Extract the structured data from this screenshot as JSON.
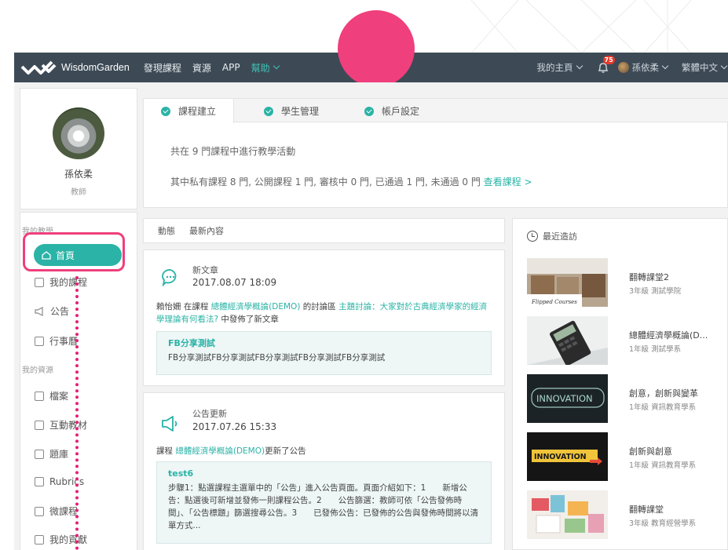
{
  "navbar": {
    "brand": "WisdomGarden",
    "links": [
      "發現課程",
      "資源",
      "APP"
    ],
    "help": "幫助",
    "my_home": "我的主頁",
    "notification_count": "75",
    "user": "孫依柔",
    "language": "繁體中文"
  },
  "profile": {
    "name": "孫依柔",
    "role": "教師"
  },
  "sidebar": {
    "section_teaching": "我的教學",
    "home": "首頁",
    "my_courses": "我的課程",
    "announcements": "公告",
    "calendar": "行事曆",
    "section_resources": "我的資源",
    "files": "檔案",
    "interactive": "互動教材",
    "question_bank": "題庫",
    "rubrics": "Rubrics",
    "micro_course": "微課程",
    "contributions": "我的貢獻"
  },
  "tabs": [
    {
      "label": "課程建立"
    },
    {
      "label": "學生管理"
    },
    {
      "label": "帳戶設定"
    }
  ],
  "summary": {
    "line1": "共在 9 門課程中進行教學活動",
    "line2": "其中私有課程 8 門, 公開課程 1 門, 審核中 0 門, 已通過 1 門, 未通過 0 門",
    "view_link": "查看課程 >"
  },
  "feed": {
    "tab_activity": "動態",
    "tab_latest": "最新內容",
    "card1": {
      "type": "新文章",
      "time": "2017.08.07 18:09",
      "text_user": "賴怡姍 在課程 ",
      "text_course": "總體經濟學概論(DEMO)",
      "text_mid": " 的討論區 ",
      "text_topic": "主題討論：大家對於古典經濟學家的經濟學理論有何看法?",
      "text_end": " 中發佈了新文章",
      "quote_title": "FB分享測試",
      "quote_body": "FB分享測試FB分享測試FB分享測試FB分享測試FB分享測試"
    },
    "card2": {
      "type": "公告更新",
      "time": "2017.07.26 15:33",
      "text_pre": "課程 ",
      "text_course": "總體經濟學概論(DEMO)",
      "text_end": "更新了公告",
      "quote_title": "test6",
      "quote_body": "步驟1：點選課程主選單中的「公告」進入公告頁面。頁面介紹如下：1　　新增公告：點選後可新增並發佈一則課程公告。2　　公告篩選：教師可依「公告發佈時間」、「公告標題」篩選搜尋公告。3　　已發佈公告：已發佈的公告與發佈時間將以清單方式..."
    }
  },
  "recent": {
    "title": "最近造訪",
    "thumb_flipped_label": "Flipped Courses",
    "thumb_innovation1_label": "INNOVATION",
    "thumb_innovation2_label": "INNOVATION",
    "courses": [
      {
        "title": "翻轉課堂2",
        "sub": "3年級 測試學院"
      },
      {
        "title": "總體經濟學概論(D...",
        "sub": "1年級 測試學系"
      },
      {
        "title": "創意，創新與變革",
        "sub": "1年級 資訊教育學系"
      },
      {
        "title": "創新與創意",
        "sub": "1年級 資訊教育學系"
      },
      {
        "title": "翻轉課堂",
        "sub": "3年級 教育經營學系"
      }
    ]
  },
  "colors": {
    "accent": "#2ab3a6",
    "navbar": "#3d4a56",
    "highlight": "#ef3f7c"
  }
}
